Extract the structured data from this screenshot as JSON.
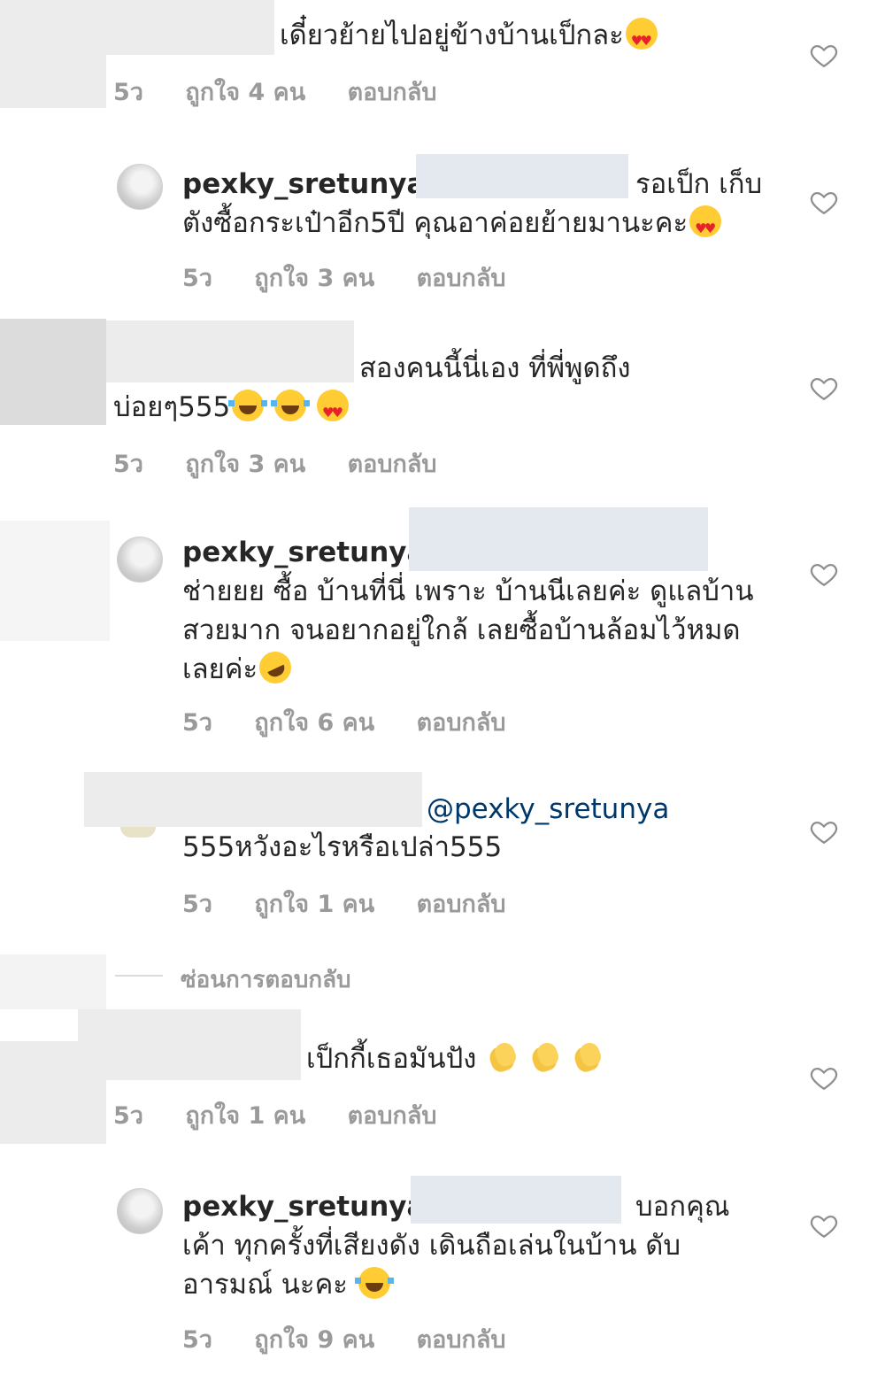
{
  "comments": [
    {
      "lines": [
        "เดี๋ยวย้ายไปอยู่ข้างบ้านเป็กละ"
      ],
      "time": "5ว",
      "likes": "ถูกใจ 4 คน",
      "reply": "ตอบกลับ"
    },
    {
      "username": "pexky_sretunya",
      "lines": [
        "รอเป็ก เก็บ",
        "ตังซื้อกระเป๋าอีก5ปี คุณอาค่อยย้ายมานะคะ"
      ],
      "time": "5ว",
      "likes": "ถูกใจ 3 คน",
      "reply": "ตอบกลับ"
    },
    {
      "lines": [
        "สองคนนี้นี่เอง ที่พี่พูดถึง",
        "บ่อยๆ555"
      ],
      "time": "5ว",
      "likes": "ถูกใจ 3 คน",
      "reply": "ตอบกลับ"
    },
    {
      "username": "pexky_sretunya",
      "lines": [
        "ช่ายยย ซื้อ บ้านที่นี่ เพราะ บ้านนีเลยค่ะ ดูแลบ้าน",
        "สวยมาก จนอยากอยู่ใกล้ เลยซื้อบ้านล้อมไว้หมด",
        "เลยค่ะ"
      ],
      "time": "5ว",
      "likes": "ถูกใจ 6 คน",
      "reply": "ตอบกลับ"
    },
    {
      "mention": "@pexky_sretunya",
      "lines": [
        "555หวังอะไรหรือเปล่า555"
      ],
      "time": "5ว",
      "likes": "ถูกใจ 1 คน",
      "reply": "ตอบกลับ"
    },
    {
      "lines": [
        "เป็กกี้เธอมันปัง"
      ],
      "time": "5ว",
      "likes": "ถูกใจ 1 คน",
      "reply": "ตอบกลับ"
    },
    {
      "username": "pexky_sretunya",
      "lines": [
        "บอกคุณ",
        "เค้า ทุกครั้งที่เสียงดัง เดินถือเล่นในบ้าน ดับ",
        "อารมณ์ นะคะ"
      ],
      "time": "5ว",
      "likes": "ถูกใจ 9 คน",
      "reply": "ตอบกลับ"
    }
  ],
  "hide_replies": "ซ่อนการตอบกลับ",
  "colors": {
    "text": "#262626",
    "meta": "#9a9a9a",
    "mention": "#00376b",
    "heart": "#8e8e8e"
  }
}
